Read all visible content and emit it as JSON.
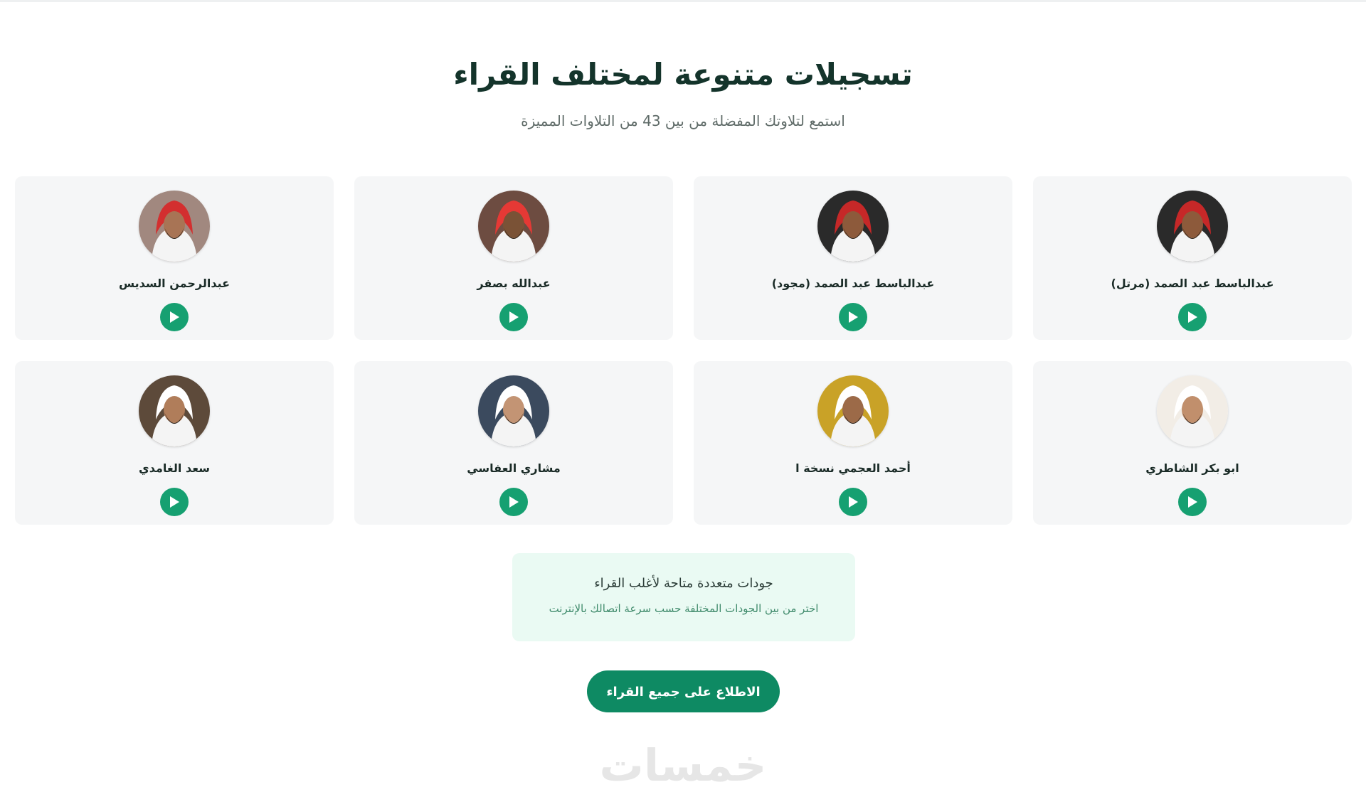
{
  "section": {
    "title": "تسجيلات متنوعة لمختلف القراء",
    "subtitle": "استمع لتلاوتك المفضلة من بين 43 من التلاوات المميزة"
  },
  "reciters": [
    {
      "name": "عبدالباسط عبد الصمد (مرتل)",
      "avatar_bg": "#2a2a2a",
      "headwear": "#c62828",
      "face": "#8d5a3b"
    },
    {
      "name": "عبدالباسط عبد الصمد (مجود)",
      "avatar_bg": "#2a2a2a",
      "headwear": "#c62828",
      "face": "#8d5a3b"
    },
    {
      "name": "عبدالله بصفر",
      "avatar_bg": "#6d4c41",
      "headwear": "#e53935",
      "face": "#7a5236"
    },
    {
      "name": "عبدالرحمن السديس",
      "avatar_bg": "#a1887f",
      "headwear": "#d32f2f",
      "face": "#a87455"
    },
    {
      "name": "ابو بكر الشاطري",
      "avatar_bg": "#f2ede6",
      "headwear": "#ffffff",
      "face": "#c18f6c"
    },
    {
      "name": "أحمد العجمي نسخة ا",
      "avatar_bg": "#c9a227",
      "headwear": "#ffffff",
      "face": "#9c6a48"
    },
    {
      "name": "مشاري العفاسي",
      "avatar_bg": "#3b4a5e",
      "headwear": "#ffffff",
      "face": "#c39474"
    },
    {
      "name": "سعد الغامدي",
      "avatar_bg": "#5d4a3a",
      "headwear": "#ffffff",
      "face": "#b07d5a"
    }
  ],
  "quality": {
    "title": "جودات متعددة متاحة لأغلب القراء",
    "description": "اختر من بين الجودات المختلفة حسب سرعة اتصالك بالإنترنت"
  },
  "cta": {
    "label": "الاطلاع على جميع القراء"
  },
  "brand": {
    "watermark": "خمسات"
  },
  "colors": {
    "accent": "#16a071",
    "cta": "#0e8a63",
    "card_bg": "#f5f6f7",
    "quality_bg": "#eafaf3"
  },
  "icons": {
    "play": "play-icon"
  }
}
